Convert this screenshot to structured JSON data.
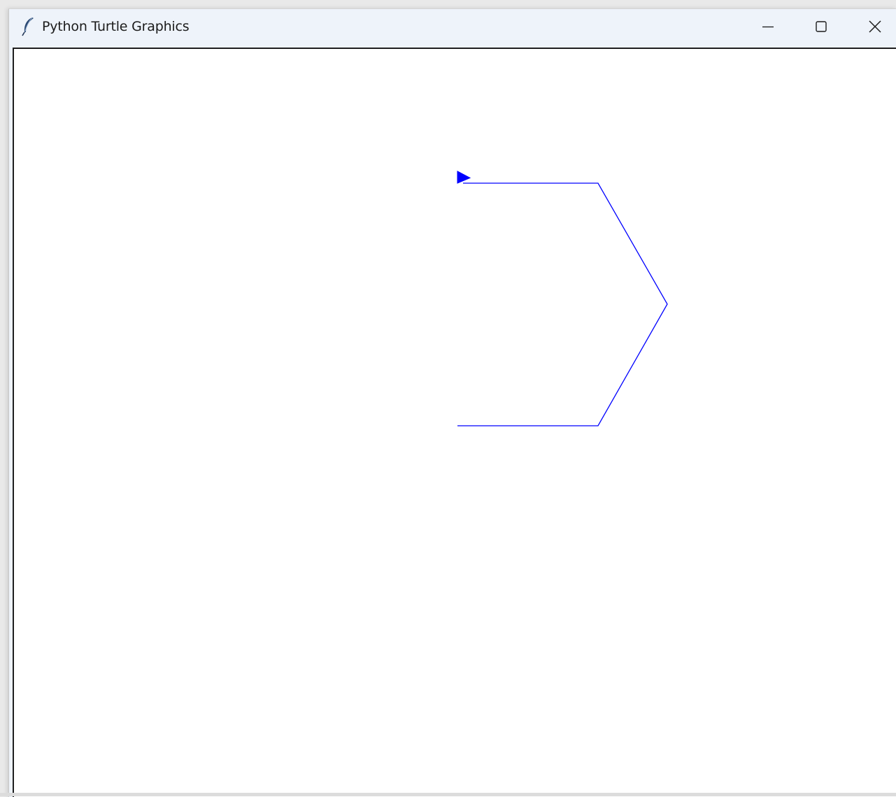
{
  "window": {
    "title": "Python Turtle Graphics",
    "icon": "feather-icon"
  },
  "controls": {
    "minimize": "minimize-icon",
    "maximize": "maximize-icon",
    "close": "close-icon"
  },
  "canvas": {
    "background": "#ffffff",
    "pen_color": "#0000ff",
    "turtle_color": "#0000ff",
    "turtle_heading": "east"
  }
}
